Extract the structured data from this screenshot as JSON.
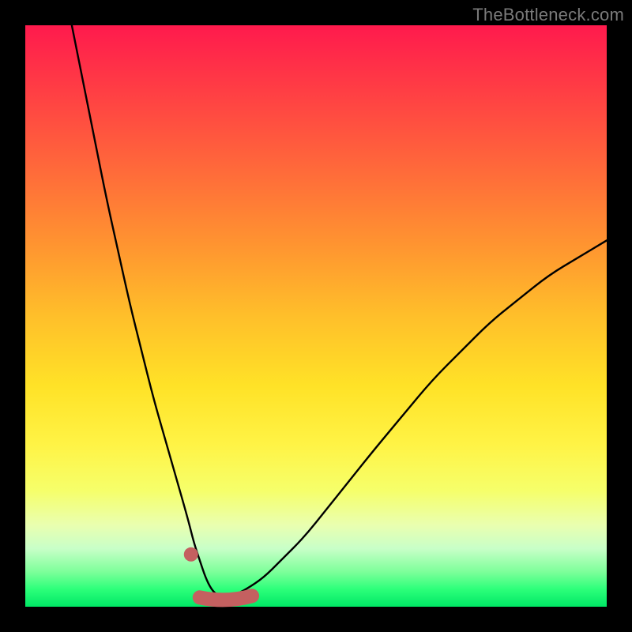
{
  "watermark": {
    "text": "TheBottleneck.com"
  },
  "colors": {
    "curve": "#000000",
    "highlight": "#c46060",
    "background_black": "#000000"
  },
  "chart_data": {
    "type": "line",
    "title": "",
    "xlabel": "",
    "ylabel": "",
    "xlim": [
      0,
      100
    ],
    "ylim": [
      0,
      100
    ],
    "series": [
      {
        "name": "bottleneck-curve",
        "x": [
          8,
          10,
          12,
          14,
          16,
          18,
          20,
          22,
          24,
          26,
          28,
          29,
          30,
          31,
          32,
          33,
          34,
          36,
          38,
          41,
          44,
          48,
          52,
          56,
          60,
          65,
          70,
          75,
          80,
          85,
          90,
          95,
          100
        ],
        "y": [
          100,
          90,
          80,
          70,
          61,
          52,
          44,
          36,
          29,
          22,
          15,
          11,
          8,
          5,
          3,
          2,
          2,
          2,
          3,
          5,
          8,
          12,
          17,
          22,
          27,
          33,
          39,
          44,
          49,
          53,
          57,
          60,
          63
        ]
      }
    ],
    "annotations": [
      {
        "name": "highlight-dot",
        "x": 28.5,
        "y": 9,
        "style": "dot"
      },
      {
        "name": "highlight-flat-region",
        "x_range": [
          30,
          39
        ],
        "y": 2,
        "style": "thick-segment"
      }
    ]
  }
}
